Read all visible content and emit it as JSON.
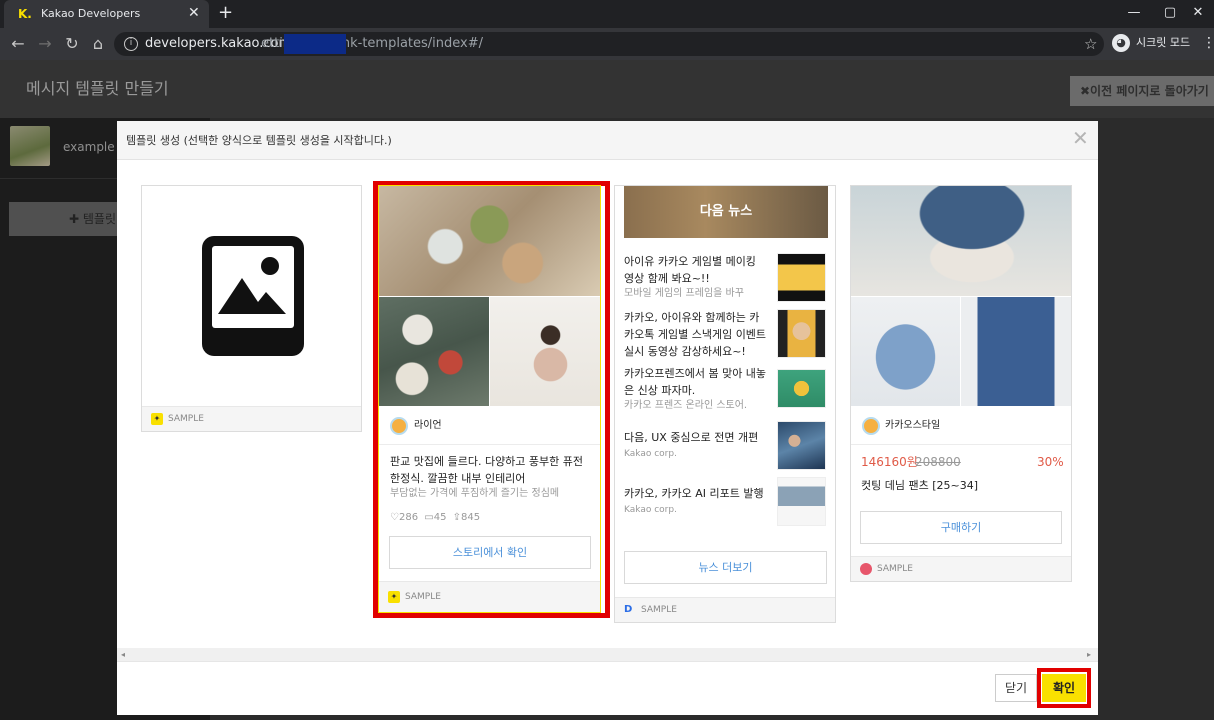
{
  "browser": {
    "tab_title": "Kakao Developers",
    "tab_favicon": "K.",
    "new_tab": "+",
    "url_host": "developers.kakao.com/app",
    "url_path": "ettings/talklink-templates/index#/",
    "incognito_label": "시크릿 모드",
    "window_controls": [
      "—",
      "▢",
      "✕"
    ]
  },
  "page": {
    "title": "메시지 템플릿 만들기",
    "back_button": "✖이전 페이지로 돌아가기",
    "profile_name": "example",
    "add_template_button": "✚ 템플릿"
  },
  "modal": {
    "title": "템플릿 생성 (선택한 양식으로 템플릿 생성을 시작합니다.)",
    "close_button": "닫기",
    "confirm_button": "확인"
  },
  "cards": {
    "blank": {
      "footer_label": "SAMPLE"
    },
    "feed": {
      "profile_name": "라이언",
      "title_line1": "판교 맛집에 들르다. 다양하고 풍부한 퓨전",
      "title_line2": "한정식. 깔끔한 내부 인테리어",
      "description": "부담없는 가격에 푸짐하게 즐기는 정심메",
      "likes": "286",
      "comments": "45",
      "shares": "845",
      "button": "스토리에서 확인",
      "footer_label": "SAMPLE"
    },
    "list": {
      "header": "다음 뉴스",
      "items": [
        {
          "title_line1": "아이유 카카오 게임별 메이킹",
          "title_line2": "영상 함께 봐요~!!",
          "subtitle": "모바일 게임의 프레임을 바꾸"
        },
        {
          "title_line1": "카카오, 아이유와 함께하는 카",
          "title_line2": "카오톡 게임별 스낵게임 이벤트",
          "title_line3": "실시 동영상 감상하세요~!"
        },
        {
          "title_line1": "카카오프렌즈에서 봄 맞아 내놓",
          "title_line2": "은 신상 파자마.",
          "subtitle": "카카오 프렌즈 온라인 스토어."
        },
        {
          "title_line1": "다음, UX 중심으로 전면 개편",
          "subtitle": "Kakao corp."
        },
        {
          "title_line1": "카카오, 카카오 AI 리포트 발행",
          "subtitle": "Kakao corp."
        }
      ],
      "button": "뉴스 더보기",
      "footer_label": "SAMPLE"
    },
    "commerce": {
      "profile_name": "카카오스타일",
      "price": "146160원",
      "original_price": "208800",
      "discount": "30%",
      "product_name": "컷팅 데님 팬츠 [25~34]",
      "button": "구매하기",
      "footer_label": "SAMPLE"
    }
  },
  "colors": {
    "kakao_yellow": "#f9e000",
    "highlight_red": "#e10000",
    "link_blue": "#4a90d9",
    "price_red": "#e05a47"
  }
}
